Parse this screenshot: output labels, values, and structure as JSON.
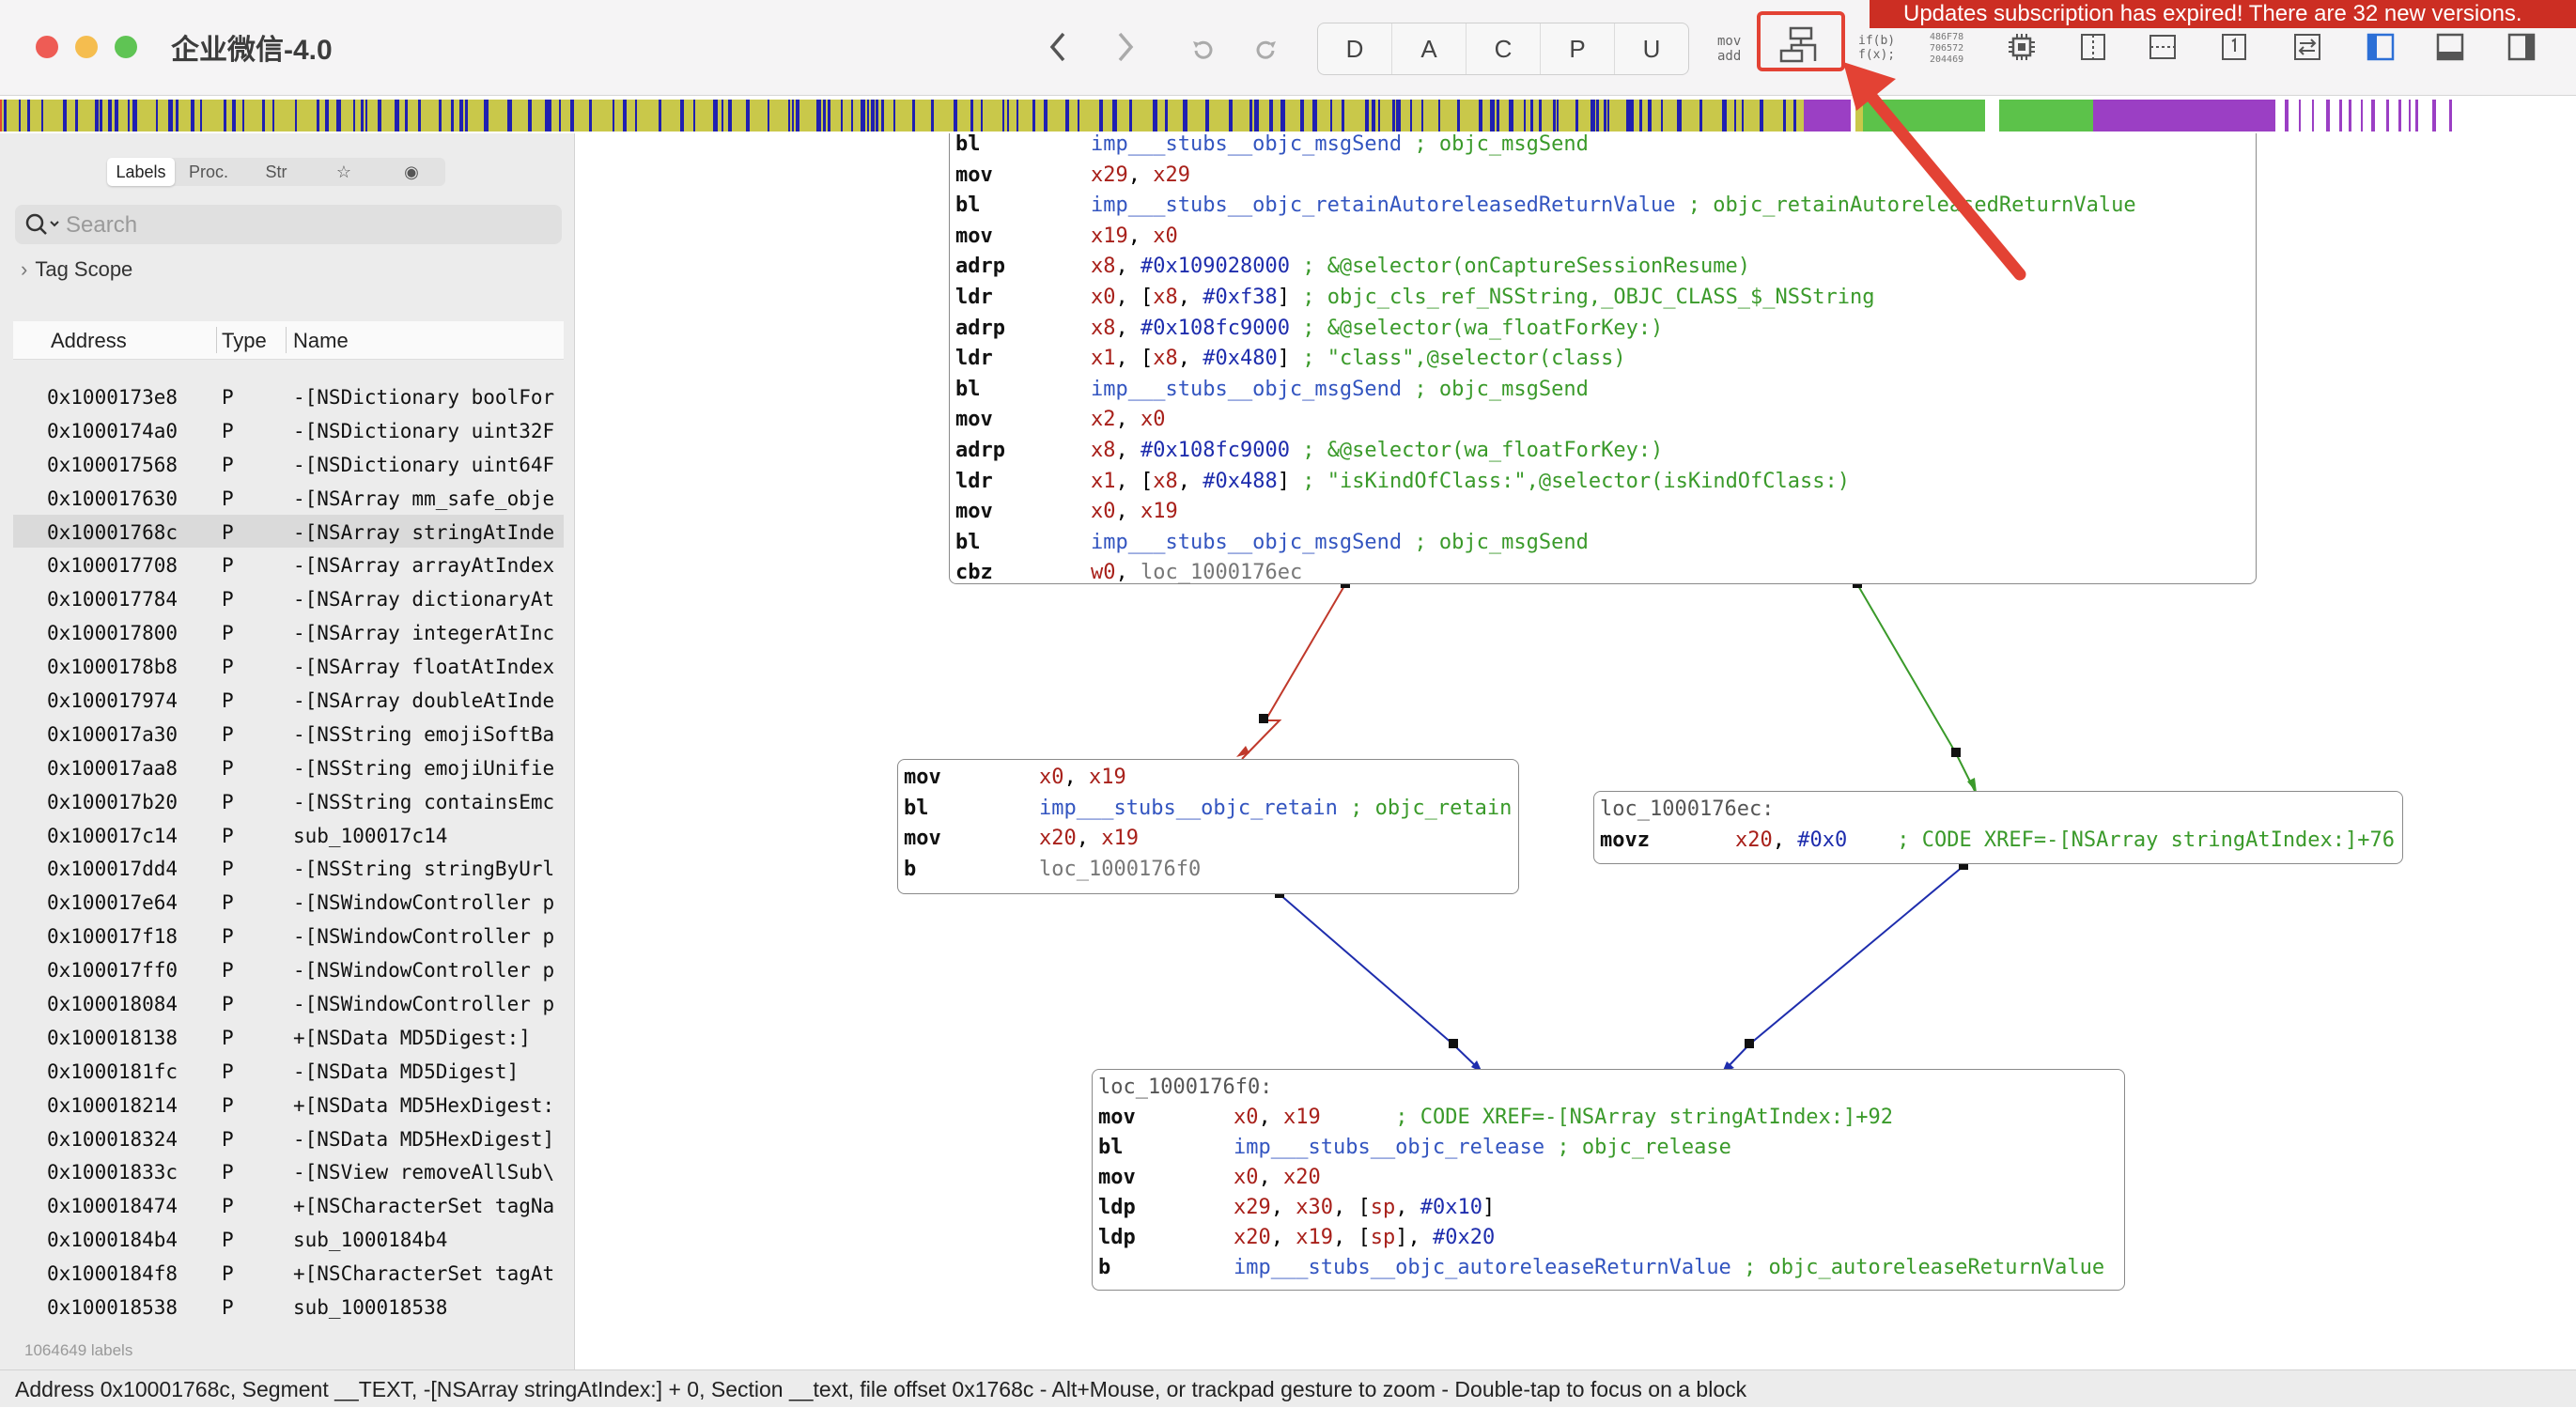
{
  "window": {
    "title": "企业微信-4.0"
  },
  "banner": {
    "text": "Updates subscription has expired! There are 32 new versions."
  },
  "toolbar": {
    "back_icon": "chevron-left-icon",
    "forward_icon": "chevron-right-icon",
    "undo_icon": "undo-icon",
    "redo_icon": "redo-icon",
    "segments": [
      "D",
      "A",
      "C",
      "P",
      "U"
    ],
    "mode_asm_line1": "mov",
    "mode_asm_line2": "add",
    "mode_pseudo_line1": "if(b)",
    "mode_pseudo_line2": "f(x);",
    "hex_line1": "486F78",
    "hex_line2": "706572",
    "hex_line3": "204469",
    "highlighted_button": "cfg-graph-button"
  },
  "colors": {
    "accent_red": "#e34234",
    "banner_red": "#cc2e23",
    "olive": "#c9c84a",
    "blue": "#2020b0",
    "green": "#5cc24a",
    "purple": "#9b3fc4"
  },
  "sidebar": {
    "tabs": [
      "Labels",
      "Proc.",
      "Str",
      "☆",
      "◉"
    ],
    "active_tab": "Labels",
    "search_placeholder": "Search",
    "tag_scope": "Tag Scope",
    "columns": [
      "Address",
      "Type",
      "Name"
    ],
    "rows": [
      {
        "address": "0x1000173e8",
        "type": "P",
        "name": "-[NSDictionary boolFor"
      },
      {
        "address": "0x1000174a0",
        "type": "P",
        "name": "-[NSDictionary uint32F"
      },
      {
        "address": "0x100017568",
        "type": "P",
        "name": "-[NSDictionary uint64F"
      },
      {
        "address": "0x100017630",
        "type": "P",
        "name": "-[NSArray mm_safe_obje"
      },
      {
        "address": "0x10001768c",
        "type": "P",
        "name": "-[NSArray stringAtInde"
      },
      {
        "address": "0x100017708",
        "type": "P",
        "name": "-[NSArray arrayAtIndex"
      },
      {
        "address": "0x100017784",
        "type": "P",
        "name": "-[NSArray dictionaryAt"
      },
      {
        "address": "0x100017800",
        "type": "P",
        "name": "-[NSArray integerAtInc"
      },
      {
        "address": "0x1000178b8",
        "type": "P",
        "name": "-[NSArray floatAtIndex"
      },
      {
        "address": "0x100017974",
        "type": "P",
        "name": "-[NSArray doubleAtInde"
      },
      {
        "address": "0x100017a30",
        "type": "P",
        "name": "-[NSString emojiSoftBa"
      },
      {
        "address": "0x100017aa8",
        "type": "P",
        "name": "-[NSString emojiUnifie"
      },
      {
        "address": "0x100017b20",
        "type": "P",
        "name": "-[NSString containsEmc"
      },
      {
        "address": "0x100017c14",
        "type": "P",
        "name": "sub_100017c14"
      },
      {
        "address": "0x100017dd4",
        "type": "P",
        "name": "-[NSString stringByUrl"
      },
      {
        "address": "0x100017e64",
        "type": "P",
        "name": "-[NSWindowController p"
      },
      {
        "address": "0x100017f18",
        "type": "P",
        "name": "-[NSWindowController p"
      },
      {
        "address": "0x100017ff0",
        "type": "P",
        "name": "-[NSWindowController p"
      },
      {
        "address": "0x100018084",
        "type": "P",
        "name": "-[NSWindowController p"
      },
      {
        "address": "0x100018138",
        "type": "P",
        "name": "+[NSData MD5Digest:]"
      },
      {
        "address": "0x1000181fc",
        "type": "P",
        "name": "-[NSData MD5Digest]"
      },
      {
        "address": "0x100018214",
        "type": "P",
        "name": "+[NSData MD5HexDigest:"
      },
      {
        "address": "0x100018324",
        "type": "P",
        "name": "-[NSData MD5HexDigest]"
      },
      {
        "address": "0x10001833c",
        "type": "P",
        "name": "-[NSView removeAllSub\\"
      },
      {
        "address": "0x100018474",
        "type": "P",
        "name": "+[NSCharacterSet tagNa"
      },
      {
        "address": "0x1000184b4",
        "type": "P",
        "name": "sub_1000184b4"
      },
      {
        "address": "0x1000184f8",
        "type": "P",
        "name": "+[NSCharacterSet tagAt"
      },
      {
        "address": "0x100018538",
        "type": "P",
        "name": "sub_100018538"
      }
    ],
    "selected_row": 4,
    "label_count": "1064649 labels"
  },
  "status_bar": {
    "text": "Address 0x10001768c, Segment __TEXT, -[NSArray stringAtIndex:] + 0, Section __text, file offset 0x1768c - Alt+Mouse, or trackpad gesture to zoom - Double-tap to focus on a block"
  },
  "graph": {
    "block1": [
      {
        "m": "bl",
        "parts": [
          [
            "sym",
            "imp___stubs__objc_msgSend"
          ],
          [
            "cmt",
            " ; objc_msgSend"
          ]
        ]
      },
      {
        "m": "mov",
        "parts": [
          [
            "reg",
            "x29"
          ],
          [
            "",
            ", "
          ],
          [
            "reg",
            "x29"
          ]
        ]
      },
      {
        "m": "bl",
        "parts": [
          [
            "sym",
            "imp___stubs__objc_retainAutoreleasedReturnValue"
          ],
          [
            "cmt",
            " ; objc_retainAutoreleasedReturnValue"
          ]
        ]
      },
      {
        "m": "mov",
        "parts": [
          [
            "reg",
            "x19"
          ],
          [
            "",
            ", "
          ],
          [
            "reg",
            "x0"
          ]
        ]
      },
      {
        "m": "adrp",
        "parts": [
          [
            "reg",
            "x8"
          ],
          [
            "",
            ", "
          ],
          [
            "num",
            "#0x109028000"
          ],
          [
            "cmt",
            " ; &@selector(onCaptureSessionResume)"
          ]
        ]
      },
      {
        "m": "ldr",
        "parts": [
          [
            "reg",
            "x0"
          ],
          [
            "",
            ", ["
          ],
          [
            "reg",
            "x8"
          ],
          [
            "",
            ", "
          ],
          [
            "num",
            "#0xf38"
          ],
          [
            "",
            "]"
          ],
          [
            "cmt",
            " ; objc_cls_ref_NSString,_OBJC_CLASS_$_NSString"
          ]
        ]
      },
      {
        "m": "adrp",
        "parts": [
          [
            "reg",
            "x8"
          ],
          [
            "",
            ", "
          ],
          [
            "num",
            "#0x108fc9000"
          ],
          [
            "cmt",
            " ; &@selector(wa_floatForKey:)"
          ]
        ]
      },
      {
        "m": "ldr",
        "parts": [
          [
            "reg",
            "x1"
          ],
          [
            "",
            ", ["
          ],
          [
            "reg",
            "x8"
          ],
          [
            "",
            ", "
          ],
          [
            "num",
            "#0x480"
          ],
          [
            "",
            "]"
          ],
          [
            "cmt",
            " ; \"class\",@selector(class)"
          ]
        ]
      },
      {
        "m": "bl",
        "parts": [
          [
            "sym",
            "imp___stubs__objc_msgSend"
          ],
          [
            "cmt",
            " ; objc_msgSend"
          ]
        ]
      },
      {
        "m": "mov",
        "parts": [
          [
            "reg",
            "x2"
          ],
          [
            "",
            ", "
          ],
          [
            "reg",
            "x0"
          ]
        ]
      },
      {
        "m": "adrp",
        "parts": [
          [
            "reg",
            "x8"
          ],
          [
            "",
            ", "
          ],
          [
            "num",
            "#0x108fc9000"
          ],
          [
            "cmt",
            " ; &@selector(wa_floatForKey:)"
          ]
        ]
      },
      {
        "m": "ldr",
        "parts": [
          [
            "reg",
            "x1"
          ],
          [
            "",
            ", ["
          ],
          [
            "reg",
            "x8"
          ],
          [
            "",
            ", "
          ],
          [
            "num",
            "#0x488"
          ],
          [
            "",
            "]"
          ],
          [
            "cmt",
            " ; \"isKindOfClass:\",@selector(isKindOfClass:)"
          ]
        ]
      },
      {
        "m": "mov",
        "parts": [
          [
            "reg",
            "x0"
          ],
          [
            "",
            ", "
          ],
          [
            "reg",
            "x19"
          ]
        ]
      },
      {
        "m": "bl",
        "parts": [
          [
            "sym",
            "imp___stubs__objc_msgSend"
          ],
          [
            "cmt",
            " ; objc_msgSend"
          ]
        ]
      },
      {
        "m": "cbz",
        "parts": [
          [
            "reg",
            "w0"
          ],
          [
            "",
            ", "
          ],
          [
            "loc",
            "loc_1000176ec"
          ]
        ]
      }
    ],
    "block2": [
      {
        "m": "mov",
        "parts": [
          [
            "reg",
            "x0"
          ],
          [
            "",
            ", "
          ],
          [
            "reg",
            "x19"
          ]
        ]
      },
      {
        "m": "bl",
        "parts": [
          [
            "sym",
            "imp___stubs__objc_retain"
          ],
          [
            "cmt",
            " ; objc_retain"
          ]
        ]
      },
      {
        "m": "mov",
        "parts": [
          [
            "reg",
            "x20"
          ],
          [
            "",
            ", "
          ],
          [
            "reg",
            "x19"
          ]
        ]
      },
      {
        "m": "b",
        "parts": [
          [
            "loc",
            "loc_1000176f0"
          ]
        ]
      }
    ],
    "block3_label": "loc_1000176ec:",
    "block3": [
      {
        "m": "movz",
        "parts": [
          [
            "reg",
            "x20"
          ],
          [
            "",
            ", "
          ],
          [
            "num",
            "#0x0"
          ],
          [
            "cmt",
            "    ; CODE XREF=-[NSArray stringAtIndex:]+76"
          ]
        ]
      }
    ],
    "block4_label": "loc_1000176f0:",
    "block4": [
      {
        "m": "mov",
        "parts": [
          [
            "reg",
            "x0"
          ],
          [
            "",
            ", "
          ],
          [
            "reg",
            "x19"
          ],
          [
            "cmt",
            "      ; CODE XREF=-[NSArray stringAtIndex:]+92"
          ]
        ]
      },
      {
        "m": "bl",
        "parts": [
          [
            "sym",
            "imp___stubs__objc_release"
          ],
          [
            "cmt",
            " ; objc_release"
          ]
        ]
      },
      {
        "m": "mov",
        "parts": [
          [
            "reg",
            "x0"
          ],
          [
            "",
            ", "
          ],
          [
            "reg",
            "x20"
          ]
        ]
      },
      {
        "m": "ldp",
        "parts": [
          [
            "reg",
            "x29"
          ],
          [
            "",
            ", "
          ],
          [
            "reg",
            "x30"
          ],
          [
            "",
            ", ["
          ],
          [
            "reg",
            "sp"
          ],
          [
            "",
            ", "
          ],
          [
            "num",
            "#0x10"
          ],
          [
            "",
            "]"
          ]
        ]
      },
      {
        "m": "ldp",
        "parts": [
          [
            "reg",
            "x20"
          ],
          [
            "",
            ", "
          ],
          [
            "reg",
            "x19"
          ],
          [
            "",
            ", ["
          ],
          [
            "reg",
            "sp"
          ],
          [
            "",
            "], "
          ],
          [
            "num",
            "#0x20"
          ]
        ]
      },
      {
        "m": "b",
        "parts": [
          [
            "sym",
            "imp___stubs__objc_autoreleaseReturnValue"
          ],
          [
            "cmt",
            " ; objc_autoreleaseReturnValue"
          ]
        ]
      }
    ]
  }
}
